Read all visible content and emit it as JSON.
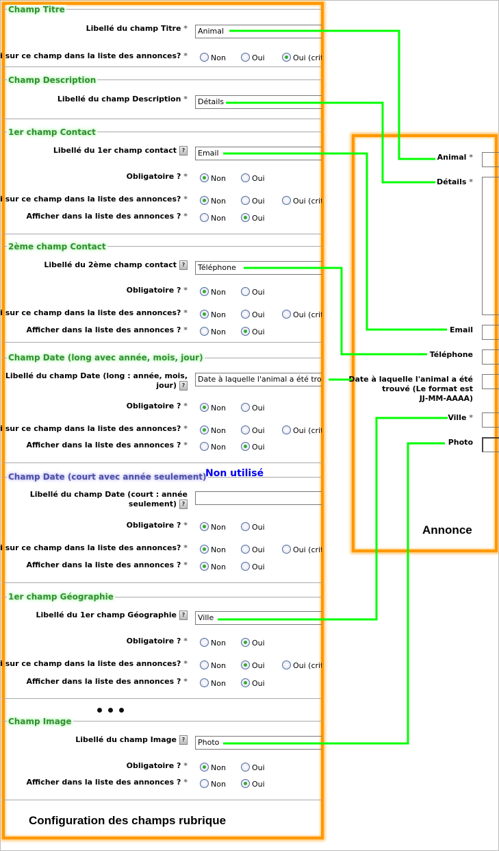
{
  "config_panel": {
    "title": "Configuration des champs rubrique",
    "ellipsis": "•••",
    "sections": [
      {
        "legend": "Champ Titre",
        "rows": [
          {
            "type": "input",
            "label": "Libellé du champ Titre",
            "required": true,
            "help": false,
            "value": "Animal"
          },
          {
            "type": "radio",
            "label": "Tri sur ce champ dans la liste des annonces?",
            "required": true,
            "options": [
              "Non",
              "Oui",
              "Oui (crit"
            ],
            "selected": 2
          }
        ]
      },
      {
        "legend": "Champ Description",
        "rows": [
          {
            "type": "input",
            "label": "Libellé du champ Description",
            "required": true,
            "help": false,
            "value": "Détails"
          }
        ]
      },
      {
        "legend": "1er champ Contact",
        "rows": [
          {
            "type": "input",
            "label": "Libellé du 1er champ contact",
            "help": true,
            "value": "Email"
          },
          {
            "type": "radio",
            "label": "Obligatoire ?",
            "required": true,
            "options": [
              "Non",
              "Oui"
            ],
            "selected": 0
          },
          {
            "type": "radio",
            "label": "Tri sur ce champ dans la liste des annonces?",
            "required": true,
            "options": [
              "Non",
              "Oui",
              "Oui (crit"
            ],
            "selected": 0
          },
          {
            "type": "radio",
            "label": "Afficher dans la liste des annonces ?",
            "required": true,
            "options": [
              "Non",
              "Oui"
            ],
            "selected": 1
          }
        ]
      },
      {
        "legend": "2ème champ Contact",
        "rows": [
          {
            "type": "input",
            "label": "Libellé du 2ème champ contact",
            "help": true,
            "value": "Téléphone"
          },
          {
            "type": "radio",
            "label": "Obligatoire ?",
            "required": true,
            "options": [
              "Non",
              "Oui"
            ],
            "selected": 0
          },
          {
            "type": "radio",
            "label": "Tri sur ce champ dans la liste des annonces?",
            "required": true,
            "options": [
              "Non",
              "Oui",
              "Oui (crit"
            ],
            "selected": 0
          },
          {
            "type": "radio",
            "label": "Afficher dans la liste des annonces ?",
            "required": true,
            "options": [
              "Non",
              "Oui"
            ],
            "selected": 1
          }
        ]
      },
      {
        "legend": "Champ Date (long avec année, mois, jour)",
        "rows": [
          {
            "type": "input",
            "label": "Libellé du champ Date (long : année, mois,",
            "label2": "jour)",
            "help": true,
            "value": "Date à laquelle l'animal a été trouvé"
          },
          {
            "type": "radio",
            "label": "Obligatoire ?",
            "required": true,
            "options": [
              "Non",
              "Oui"
            ],
            "selected": 0
          },
          {
            "type": "radio",
            "label": "Tri sur ce champ dans la liste des annonces?",
            "required": true,
            "options": [
              "Non",
              "Oui",
              "Oui (crit"
            ],
            "selected": 0
          },
          {
            "type": "radio",
            "label": "Afficher dans la liste des annonces ?",
            "required": true,
            "options": [
              "Non",
              "Oui"
            ],
            "selected": 1
          }
        ]
      },
      {
        "legend": "Champ Date (court avec année seulement)",
        "unused": "Non utilisé",
        "rows": [
          {
            "type": "input",
            "label": "Libellé du champ Date (court : année",
            "label2": "seulement)",
            "help": true,
            "value": ""
          },
          {
            "type": "radio",
            "label": "Obligatoire ?",
            "required": true,
            "options": [
              "Non",
              "Oui"
            ],
            "selected": 0
          },
          {
            "type": "radio",
            "label": "Tri sur ce champ dans la liste des annonces?",
            "required": true,
            "options": [
              "Non",
              "Oui",
              "Oui (crit"
            ],
            "selected": 0
          },
          {
            "type": "radio",
            "label": "Afficher dans la liste des annonces ?",
            "required": true,
            "options": [
              "Non",
              "Oui"
            ],
            "selected": 0
          }
        ]
      },
      {
        "legend": "1er champ Géographie",
        "rows": [
          {
            "type": "input",
            "label": "Libellé du 1er champ Géographie",
            "help": true,
            "value": "Ville"
          },
          {
            "type": "radio",
            "label": "Obligatoire ?",
            "required": true,
            "options": [
              "Non",
              "Oui"
            ],
            "selected": 1
          },
          {
            "type": "radio",
            "label": "Tri sur ce champ dans la liste des annonces?",
            "required": true,
            "options": [
              "Non",
              "Oui",
              "Oui (crit"
            ],
            "selected": 1
          },
          {
            "type": "radio",
            "label": "Afficher dans la liste des annonces ?",
            "required": true,
            "options": [
              "Non",
              "Oui"
            ],
            "selected": 1
          }
        ]
      },
      {
        "legend": "Champ Image",
        "rows": [
          {
            "type": "input",
            "label": "Libellé du champ Image",
            "help": true,
            "value": "Photo"
          },
          {
            "type": "radio",
            "label": "Obligatoire ?",
            "required": true,
            "options": [
              "Non",
              "Oui"
            ],
            "selected": 0
          },
          {
            "type": "radio",
            "label": "Afficher dans la liste des annonces ?",
            "required": true,
            "options": [
              "Non",
              "Oui"
            ],
            "selected": 1
          }
        ]
      }
    ]
  },
  "annonce_panel": {
    "title": "Annonce",
    "fields": [
      {
        "label": "Animal",
        "required": true
      },
      {
        "label": "Détails",
        "required": true
      },
      {
        "label": "Email",
        "required": false
      },
      {
        "label": "Téléphone",
        "required": false
      },
      {
        "label": "Date à laquelle l'animal a été",
        "label2": "trouvé (Le format est",
        "label3": "JJ-MM-AAAA)",
        "required": false
      },
      {
        "label": "Ville",
        "required": true
      },
      {
        "label": "Photo",
        "required": false
      }
    ]
  },
  "colors": {
    "panel_border": "#ff9800",
    "connector": "#00ff00",
    "legend": "#3a8a3a",
    "unused": "#0000ee"
  }
}
